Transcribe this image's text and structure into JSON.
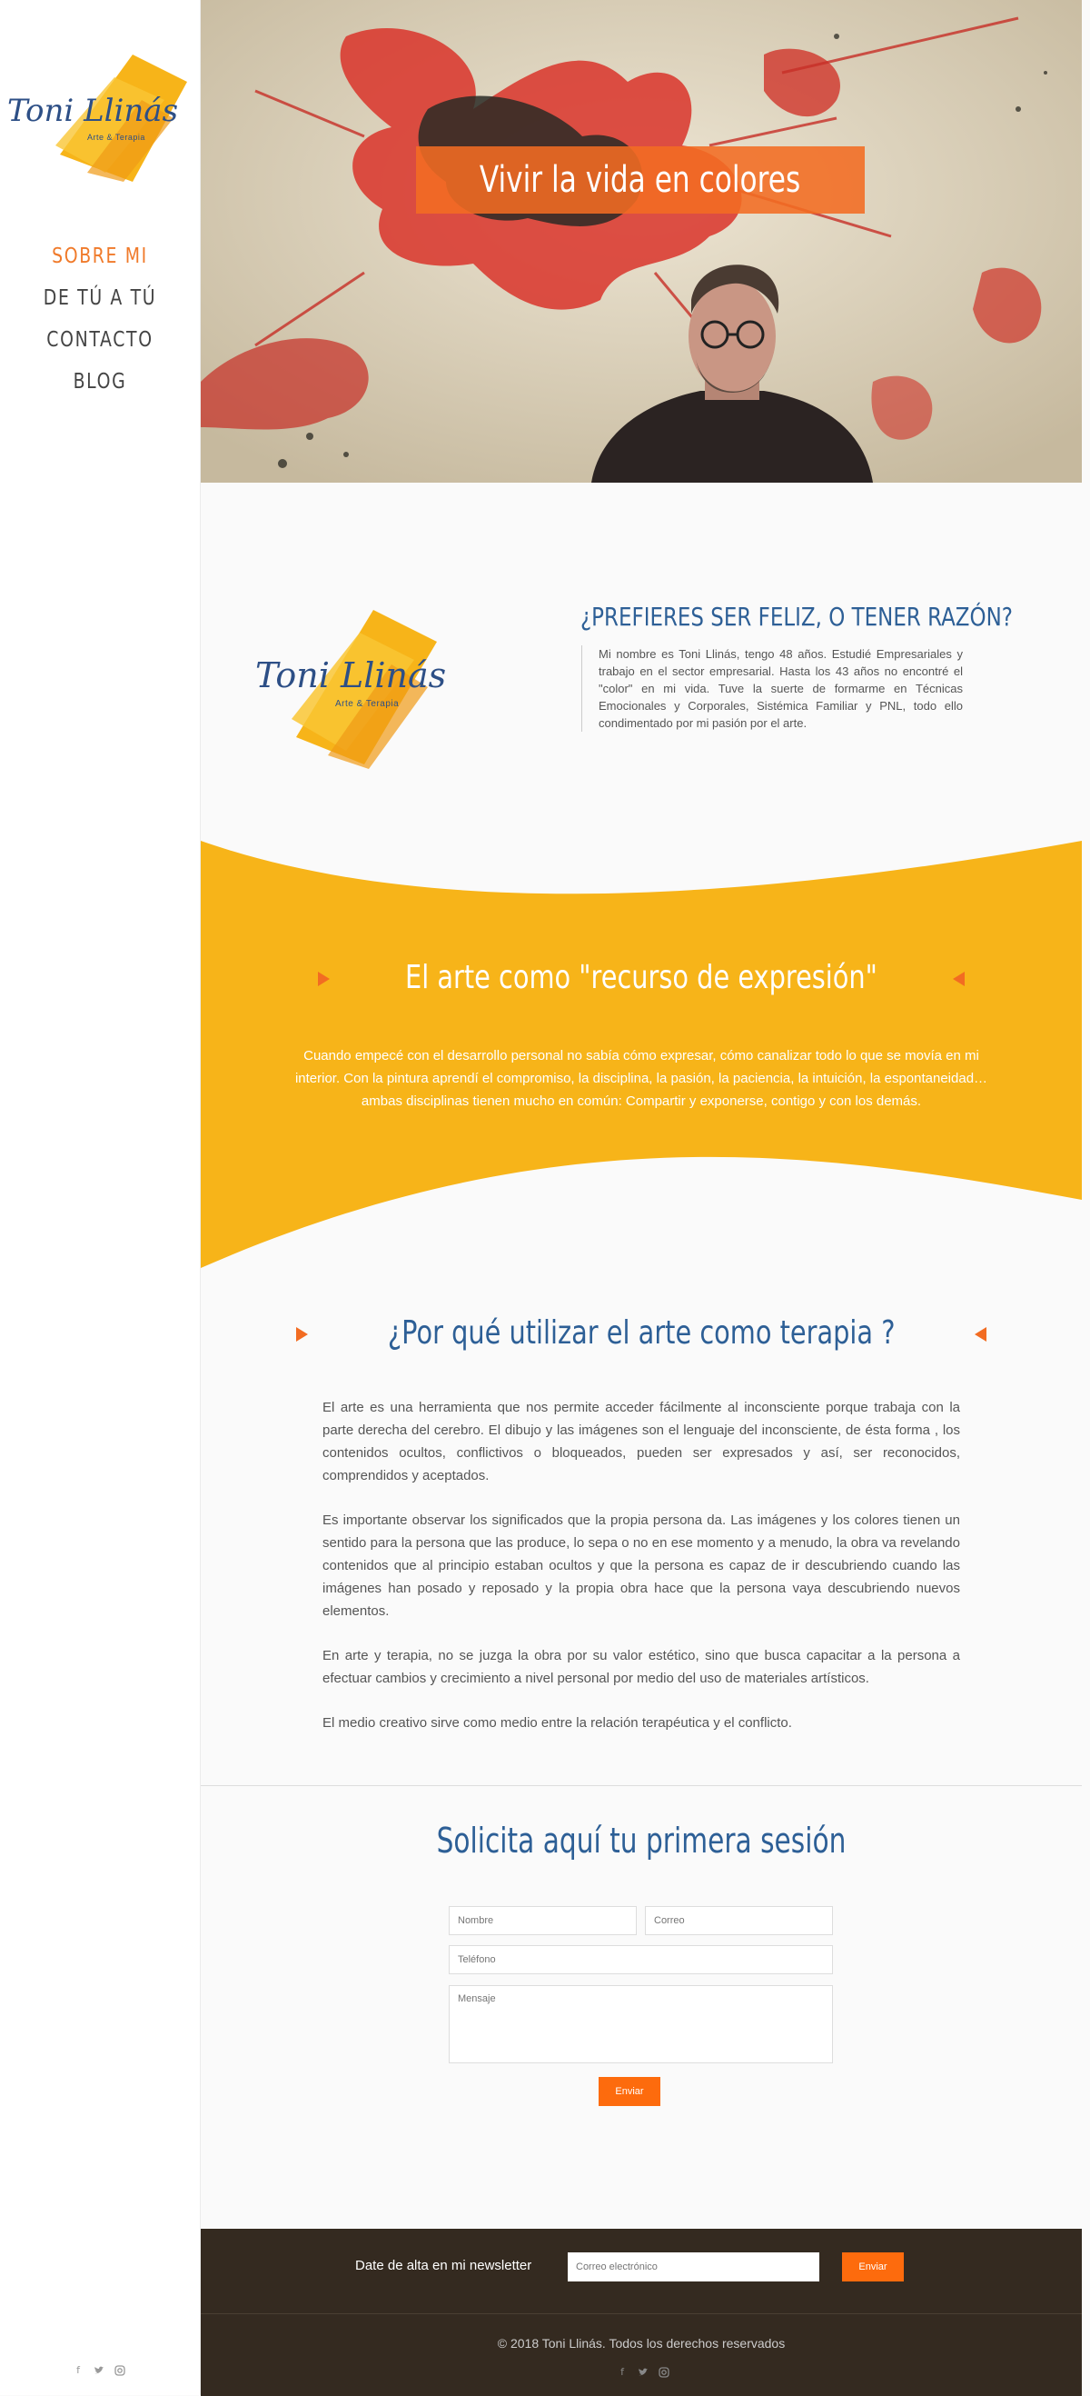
{
  "logo": {
    "name": "Toni Llinás",
    "tagline": "Arte & Terapia"
  },
  "nav": [
    {
      "label": "SOBRE MI",
      "active": true
    },
    {
      "label": "DE TÚ A TÚ",
      "active": false
    },
    {
      "label": "CONTACTO",
      "active": false
    },
    {
      "label": "BLOG",
      "active": false
    }
  ],
  "social_icons": [
    "facebook-icon",
    "twitter-icon",
    "instagram-icon"
  ],
  "hero": {
    "title": "Vivir la vida en colores"
  },
  "intro": {
    "title": "¿PREFIERES SER FELIZ, O TENER RAZÓN?",
    "text": "Mi nombre es Toni Llinás, tengo 48 años. Estudié Empresariales y trabajo en el sector empresarial. Hasta los 43 años no encontré el \"color\" en mi vida. Tuve la suerte de formarme en Técnicas Emocionales y Corporales, Sistémica Familiar y PNL, todo ello condimentado por mi pasión por el arte."
  },
  "band": {
    "title": "El arte como \"recurso de expresión\"",
    "text": "Cuando empecé con el desarrollo personal no sabía cómo expresar, cómo canalizar todo lo que se movía en mi interior. Con la pintura aprendí el compromiso, la disciplina, la pasión, la paciencia, la intuición, la espontaneidad… ambas disciplinas tienen mucho en común: Compartir y exponerse, contigo y con los demás."
  },
  "why": {
    "title": "¿Por qué utilizar el arte como terapia ?",
    "paragraphs": [
      "El arte es una herramienta que nos permite acceder fácilmente al inconsciente porque trabaja con la parte derecha del cerebro. El dibujo y las imágenes son el lenguaje del inconsciente, de ésta forma , los contenidos ocultos, conflictivos o bloqueados, pueden ser expresados y así, ser reconocidos, comprendidos y aceptados.",
      "Es importante observar los significados que la propia persona da. Las imágenes y los colores tienen un sentido para la persona que las produce, lo sepa o no en ese momento y a menudo, la obra va revelando contenidos que al principio estaban ocultos y que la persona es capaz de ir descubriendo cuando las imágenes han posado y reposado y la propia obra hace que la persona vaya descubriendo nuevos elementos.",
      "En arte y terapia, no se juzga la obra por su valor estético, sino que busca capacitar a la persona a efectuar cambios y crecimiento a nivel personal por medio del uso de materiales artísticos.",
      "El medio creativo sirve como medio entre la relación terapéutica y el conflicto."
    ]
  },
  "form": {
    "title": "Solicita aquí tu primera sesión",
    "name_placeholder": "Nombre",
    "email_placeholder": "Correo",
    "phone_placeholder": "Teléfono",
    "message_placeholder": "Mensaje",
    "submit_label": "Enviar"
  },
  "newsletter": {
    "label": "Date de alta en mi newsletter",
    "email_placeholder": "Correo electrónico",
    "submit_label": "Enviar"
  },
  "footer": {
    "copyright": "© 2018 Toni Llinás. Todos los derechos reservados"
  },
  "colors": {
    "accent": "#f07a2a",
    "blue": "#2d5f96",
    "yellow": "#f7b419",
    "dark": "#342a20"
  }
}
